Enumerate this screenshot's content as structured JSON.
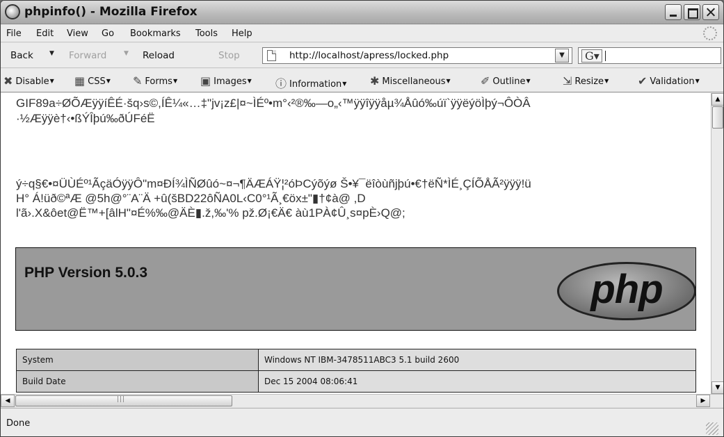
{
  "window": {
    "title": "phpinfo() - Mozilla Firefox"
  },
  "menu": [
    "File",
    "Edit",
    "View",
    "Go",
    "Bookmarks",
    "Tools",
    "Help"
  ],
  "nav": {
    "back": "Back",
    "forward": "Forward",
    "reload": "Reload",
    "stop": "Stop",
    "url": "http://localhost/apress/locked.php"
  },
  "devbar": [
    "Disable",
    "CSS",
    "Forms",
    "Images",
    "Information",
    "Miscellaneous",
    "Outline",
    "Resize",
    "Validation"
  ],
  "content": {
    "garbage_lines": [
      "GIF89a÷ØÕÆÿÿíÊÉ·šq›s©,ÍÊ¼«…‡\"jv¡z£|¤~ÌÉº•m°‹²®‰—o„‹™ÿÿîÿÿåµ¾Åûó‰úï`ÿÿëýöÌþý¬ÔÒÂ",
      "·½Æÿÿè†‹•ßÝÎþú‰ðÚFéË",
      "",
      "ý÷q§€•¤ÜÙÉº¹ÃçäÓÿÿÔ\"m¤ÐÍ¾ÌÑØûó~¤¬¶ÄÆÁŸ¦²óÞCýõýø Š•¥¯ëîòùñjþú•€†ëÑ*ÌÉ¸ÇÍÕÅÃ²ÿÿÿ!ü",
      "H° Á!üð©ªÆ @5h@°¨A¨Ä +û(šBD22ôÑA0L‹C0°¹Ã¸€öx±\"▮†¢à@ ,D",
      "l'ã›.X&ôet@Ë™+[âlH\"¤É%‰@ÄÈ▮.ž,‰'% pž.Ø¡€Ä€ àù1PÀ¢Û¸s¤pÈ›Q@;"
    ],
    "php_version": "PHP Version 5.0.3",
    "php_logo": "php",
    "table": [
      {
        "key": "System",
        "value": "Windows NT IBM-3478511ABC3 5.1 build 2600"
      },
      {
        "key": "Build Date",
        "value": "Dec 15 2004 08:06:41"
      }
    ]
  },
  "status": "Done"
}
